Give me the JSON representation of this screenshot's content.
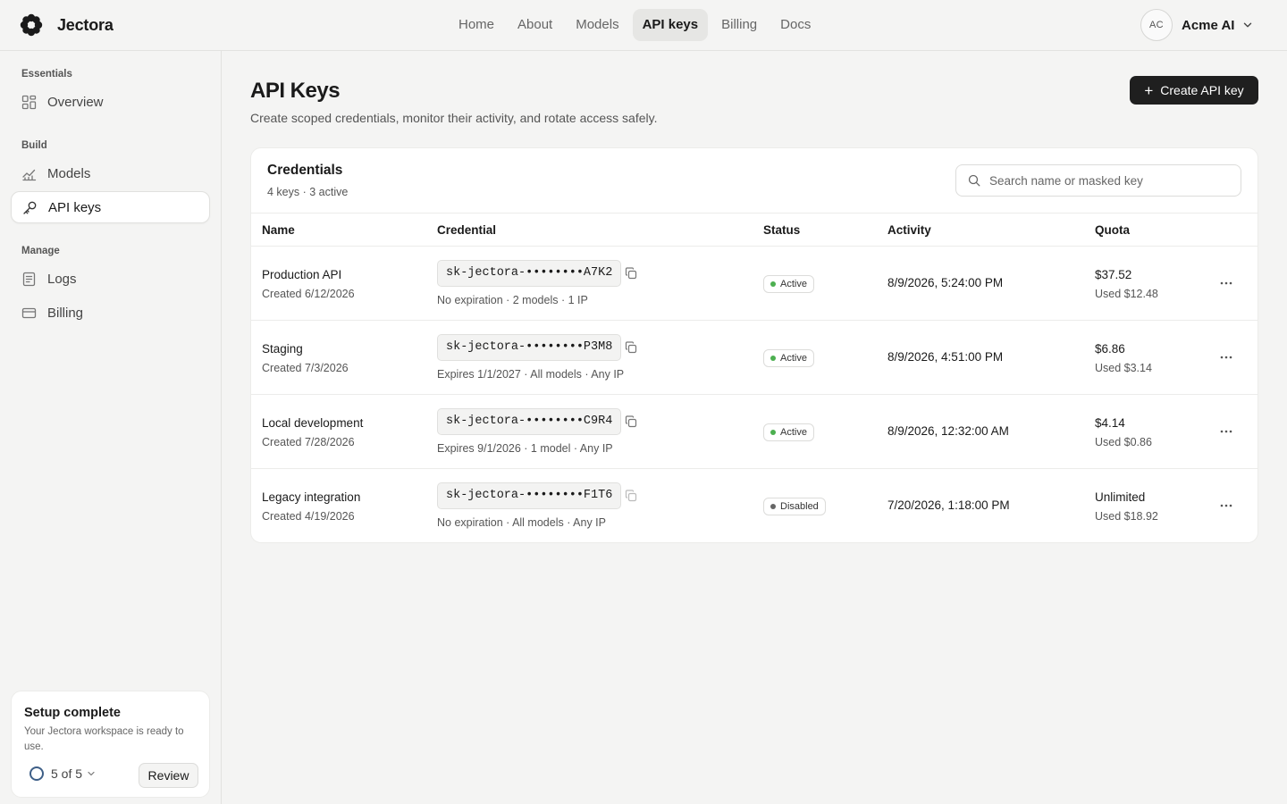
{
  "app": {
    "brand": "Jectora",
    "logo_icon": "flower-logo-icon"
  },
  "nav": {
    "items": [
      {
        "label": "Home"
      },
      {
        "label": "About"
      },
      {
        "label": "Models"
      },
      {
        "label": "API keys",
        "active": true
      },
      {
        "label": "Billing"
      },
      {
        "label": "Docs"
      }
    ]
  },
  "account": {
    "initials": "AC",
    "name": "Acme AI"
  },
  "sidebar": {
    "sections": [
      {
        "label": "Essentials"
      },
      {
        "label": "Build"
      },
      {
        "label": "Manage"
      }
    ],
    "items": [
      {
        "label": "Overview",
        "icon": "grid-icon"
      },
      {
        "label": "Models",
        "icon": "chart-icon"
      },
      {
        "label": "API keys",
        "icon": "key-icon",
        "active": true
      },
      {
        "label": "Logs",
        "icon": "logs-icon"
      },
      {
        "label": "Billing",
        "icon": "card-icon"
      }
    ]
  },
  "setup": {
    "title": "Setup complete",
    "description": "Your Jectora workspace is ready to use.",
    "progress": "5 of 5",
    "review_label": "Review"
  },
  "page": {
    "title": "API Keys",
    "subtitle": "Create scoped credentials, monitor their activity, and rotate access safely.",
    "create_label": "Create API key"
  },
  "credentials": {
    "title": "Credentials",
    "summary": "4 keys · 3 active",
    "search_placeholder": "Search name or masked key",
    "columns": [
      "Name",
      "Credential",
      "Status",
      "Activity",
      "Quota"
    ],
    "rows": [
      {
        "name": "Production API",
        "created": "Created 6/12/2026",
        "key": "sk-jectora-••••••••A7K2",
        "meta": "No expiration · 2 models · 1 IP",
        "status": "Active",
        "activity": "8/9/2026, 5:24:00 PM",
        "quota": "$37.52",
        "used": "Used $12.48"
      },
      {
        "name": "Staging",
        "created": "Created 7/3/2026",
        "key": "sk-jectora-••••••••P3M8",
        "meta": "Expires 1/1/2027 · All models · Any IP",
        "status": "Active",
        "activity": "8/9/2026, 4:51:00 PM",
        "quota": "$6.86",
        "used": "Used $3.14"
      },
      {
        "name": "Local development",
        "created": "Created 7/28/2026",
        "key": "sk-jectora-••••••••C9R4",
        "meta": "Expires 9/1/2026 · 1 model · Any IP",
        "status": "Active",
        "activity": "8/9/2026, 12:32:00 AM",
        "quota": "$4.14",
        "used": "Used $0.86"
      },
      {
        "name": "Legacy integration",
        "created": "Created 4/19/2026",
        "key": "sk-jectora-••••••••F1T6",
        "meta": "No expiration · All models · Any IP",
        "status": "Disabled",
        "activity": "7/20/2026, 1:18:00 PM",
        "quota": "Unlimited",
        "used": "Used $18.92"
      }
    ]
  },
  "colors": {
    "accent_dark": "#1f1f1f",
    "status_active": "#4caf50",
    "status_disabled": "#666666",
    "progress_ring": "#3e5f87"
  }
}
